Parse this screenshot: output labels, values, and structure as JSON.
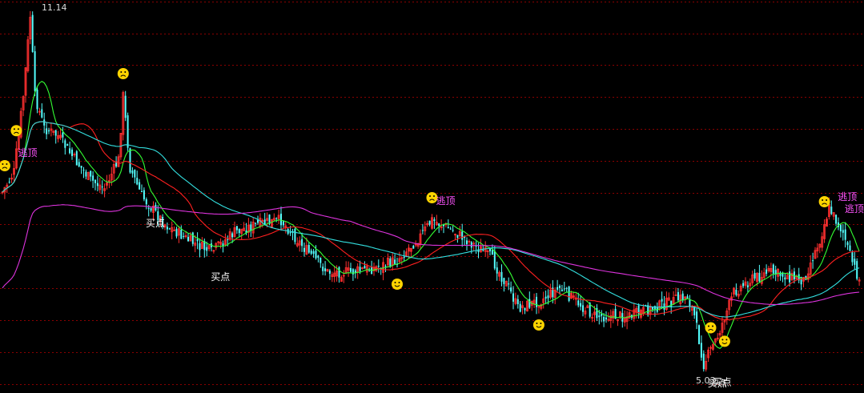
{
  "chart_data": {
    "type": "candlestick",
    "title": "",
    "grid": true,
    "annotations": {
      "high_price_label": "11.14",
      "low_price_label": "5.03",
      "buy_label": "买点",
      "escape_top_label": "逃顶"
    },
    "price_range": [
      4.8,
      11.4
    ],
    "moving_averages": [
      {
        "name": "",
        "color": "#33ff33"
      },
      {
        "name": "",
        "color": "#ff2020"
      },
      {
        "name": "",
        "color": "#33e0e0"
      },
      {
        "name": "",
        "color": "#dd33dd"
      }
    ],
    "signals": [
      {
        "type": "escape_top",
        "label": "逃顶",
        "index": 5
      },
      {
        "type": "escape_top",
        "label": "逃顶",
        "index": 185
      },
      {
        "type": "escape_top",
        "label": "逃顶",
        "index": 358
      },
      {
        "type": "escape_top",
        "label": "逃顶",
        "index": 361
      },
      {
        "type": "buy",
        "label": "买点",
        "index": 60
      },
      {
        "type": "buy",
        "label": "买点",
        "index": 88
      },
      {
        "type": "buy",
        "label": "买点",
        "index": 304
      },
      {
        "type": "buy",
        "label": "买点",
        "index": 302
      }
    ],
    "face_markers": [
      {
        "mood": "sad",
        "index": 1
      },
      {
        "mood": "sad",
        "index": 6
      },
      {
        "mood": "sad",
        "index": 52
      },
      {
        "mood": "sad",
        "index": 185
      },
      {
        "mood": "happy",
        "index": 170
      },
      {
        "mood": "happy",
        "index": 231
      },
      {
        "mood": "sad",
        "index": 305
      },
      {
        "mood": "happy",
        "index": 311
      },
      {
        "mood": "sad",
        "index": 354
      }
    ]
  },
  "colors": {
    "up": "#ff3030",
    "down": "#54ffff",
    "grid": "#8b0000",
    "label": "#ffffff",
    "escape": "#ff55ff",
    "face": "#ffd400"
  }
}
